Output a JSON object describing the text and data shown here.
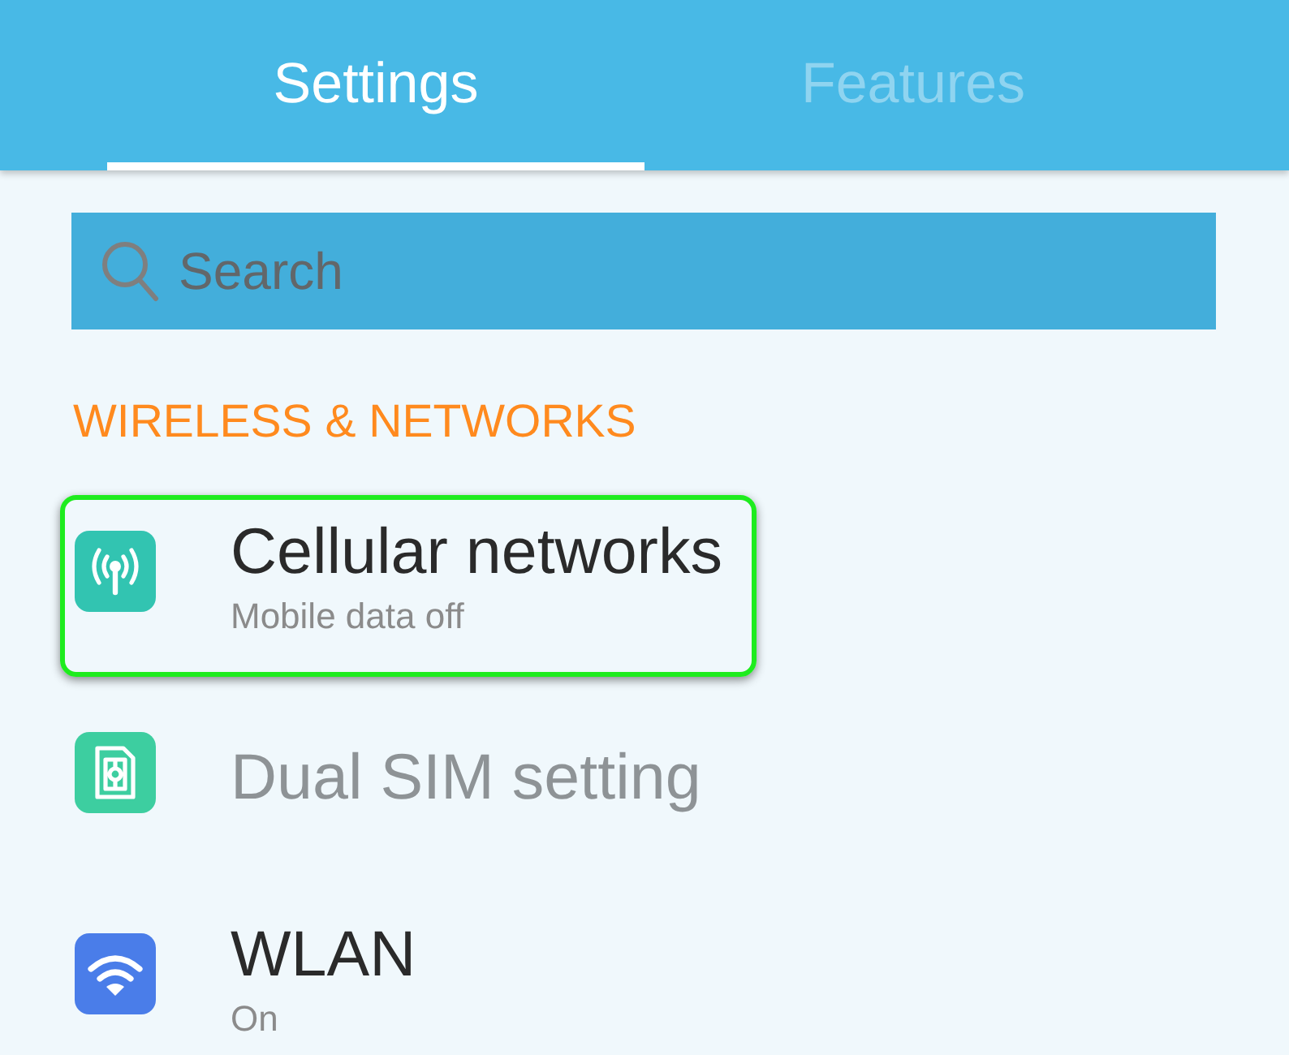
{
  "tabs": [
    {
      "label": "Settings",
      "selected": true
    },
    {
      "label": "Features",
      "selected": false
    }
  ],
  "search": {
    "placeholder": "Search"
  },
  "section": {
    "title": "WIRELESS & NETWORKS",
    "items": [
      {
        "kind": "antenna",
        "title": "Cellular networks",
        "subtitle": "Mobile data off",
        "highlighted": true,
        "disabled": false
      },
      {
        "kind": "sim",
        "title": "Dual SIM setting",
        "highlighted": false,
        "disabled": true
      },
      {
        "kind": "wifi",
        "title": "WLAN",
        "subtitle": "On",
        "highlighted": false,
        "disabled": false
      }
    ]
  }
}
